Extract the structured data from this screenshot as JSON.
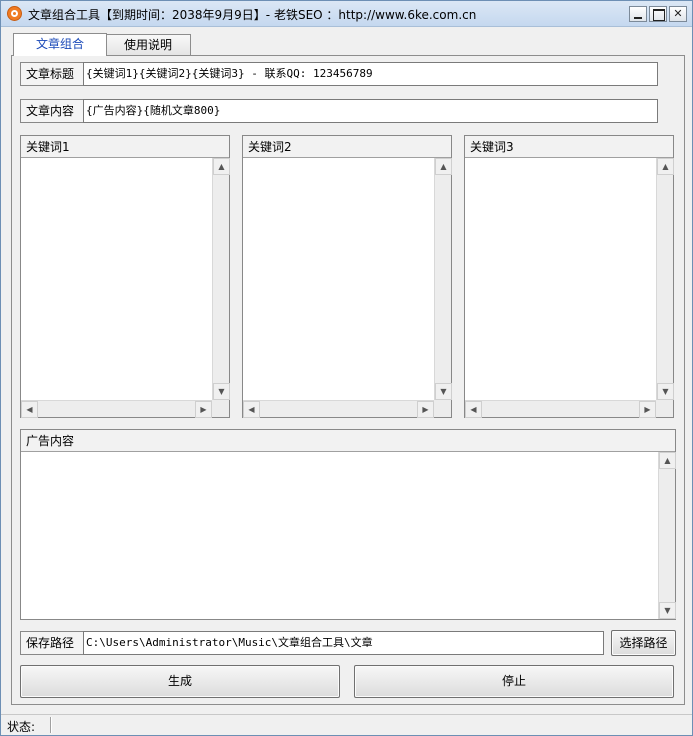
{
  "window": {
    "title": "文章组合工具【到期时间：2038年9月9日】- 老铁SEO ：http://www.6ke.com.cn",
    "app_icon": "app-logo-icon"
  },
  "tabs": [
    {
      "label": "文章组合",
      "active": true
    },
    {
      "label": "使用说明",
      "active": false
    }
  ],
  "fields": {
    "title": {
      "label": "文章标题",
      "value": "{关键词1}{关键词2}{关键词3} - 联系QQ: 123456789"
    },
    "content": {
      "label": "文章内容",
      "value": "{广告内容}{随机文章800}"
    }
  },
  "keyword_lists": [
    {
      "header": "关键词1"
    },
    {
      "header": "关键词2"
    },
    {
      "header": "关键词3"
    }
  ],
  "ad_box": {
    "header": "广告内容"
  },
  "save_path": {
    "label": "保存路径",
    "value": "C:\\Users\\Administrator\\Music\\文章组合工具\\文章",
    "browse_label": "选择路径"
  },
  "actions": {
    "generate_label": "生成",
    "stop_label": "停止"
  },
  "status": {
    "label": "状态:",
    "value": ""
  },
  "colors": {
    "active_tab_text": "#1a49b8",
    "titlebar": "#c5d8ef"
  }
}
